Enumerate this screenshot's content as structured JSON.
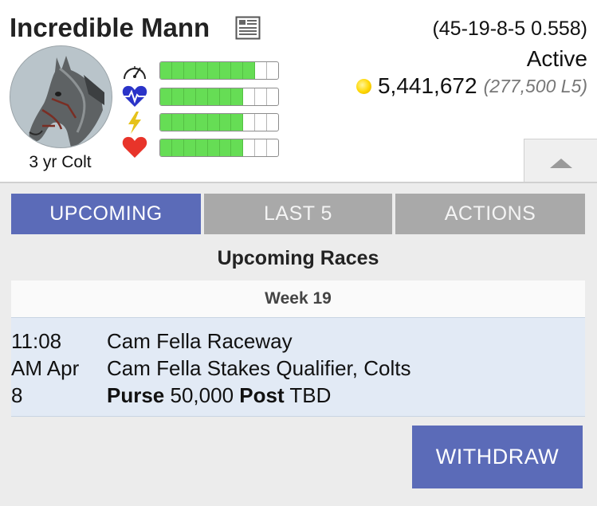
{
  "horse": {
    "name": "Incredible Mann",
    "record": "(45-19-8-5 0.558)",
    "status": "Active",
    "earnings": "5,441,672",
    "earnings_sub": "(277,500 L5)",
    "age_sex": "3 yr Colt"
  },
  "stats": [
    {
      "icon": "speedometer-icon",
      "level": 0.75,
      "filled_segments": 7.5
    },
    {
      "icon": "heart-monitor-icon",
      "level": 0.7,
      "filled_segments": 7
    },
    {
      "icon": "lightning-icon",
      "level": 0.7,
      "filled_segments": 7
    },
    {
      "icon": "heart-icon",
      "level": 0.7,
      "filled_segments": 7
    }
  ],
  "tabs": [
    {
      "label": "UPCOMING",
      "active": true
    },
    {
      "label": "LAST 5",
      "active": false
    },
    {
      "label": "ACTIONS",
      "active": false
    }
  ],
  "upcoming": {
    "title": "Upcoming Races",
    "week": "Week 19",
    "race": {
      "time_line1": "11:08",
      "time_line2": "AM Apr",
      "time_line3": "8",
      "track": "Cam Fella Raceway",
      "race_name": "Cam Fella Stakes Qualifier, Colts",
      "purse_label": "Purse",
      "purse_value": "50,000",
      "post_label": "Post",
      "post_value": "TBD"
    }
  },
  "actions": {
    "withdraw_label": "WITHDRAW"
  },
  "colors": {
    "accent": "#5b6bb8",
    "tab_inactive": "#a9a9a9",
    "bar_fill": "#66dd55",
    "row_highlight": "#e2eaf5"
  }
}
